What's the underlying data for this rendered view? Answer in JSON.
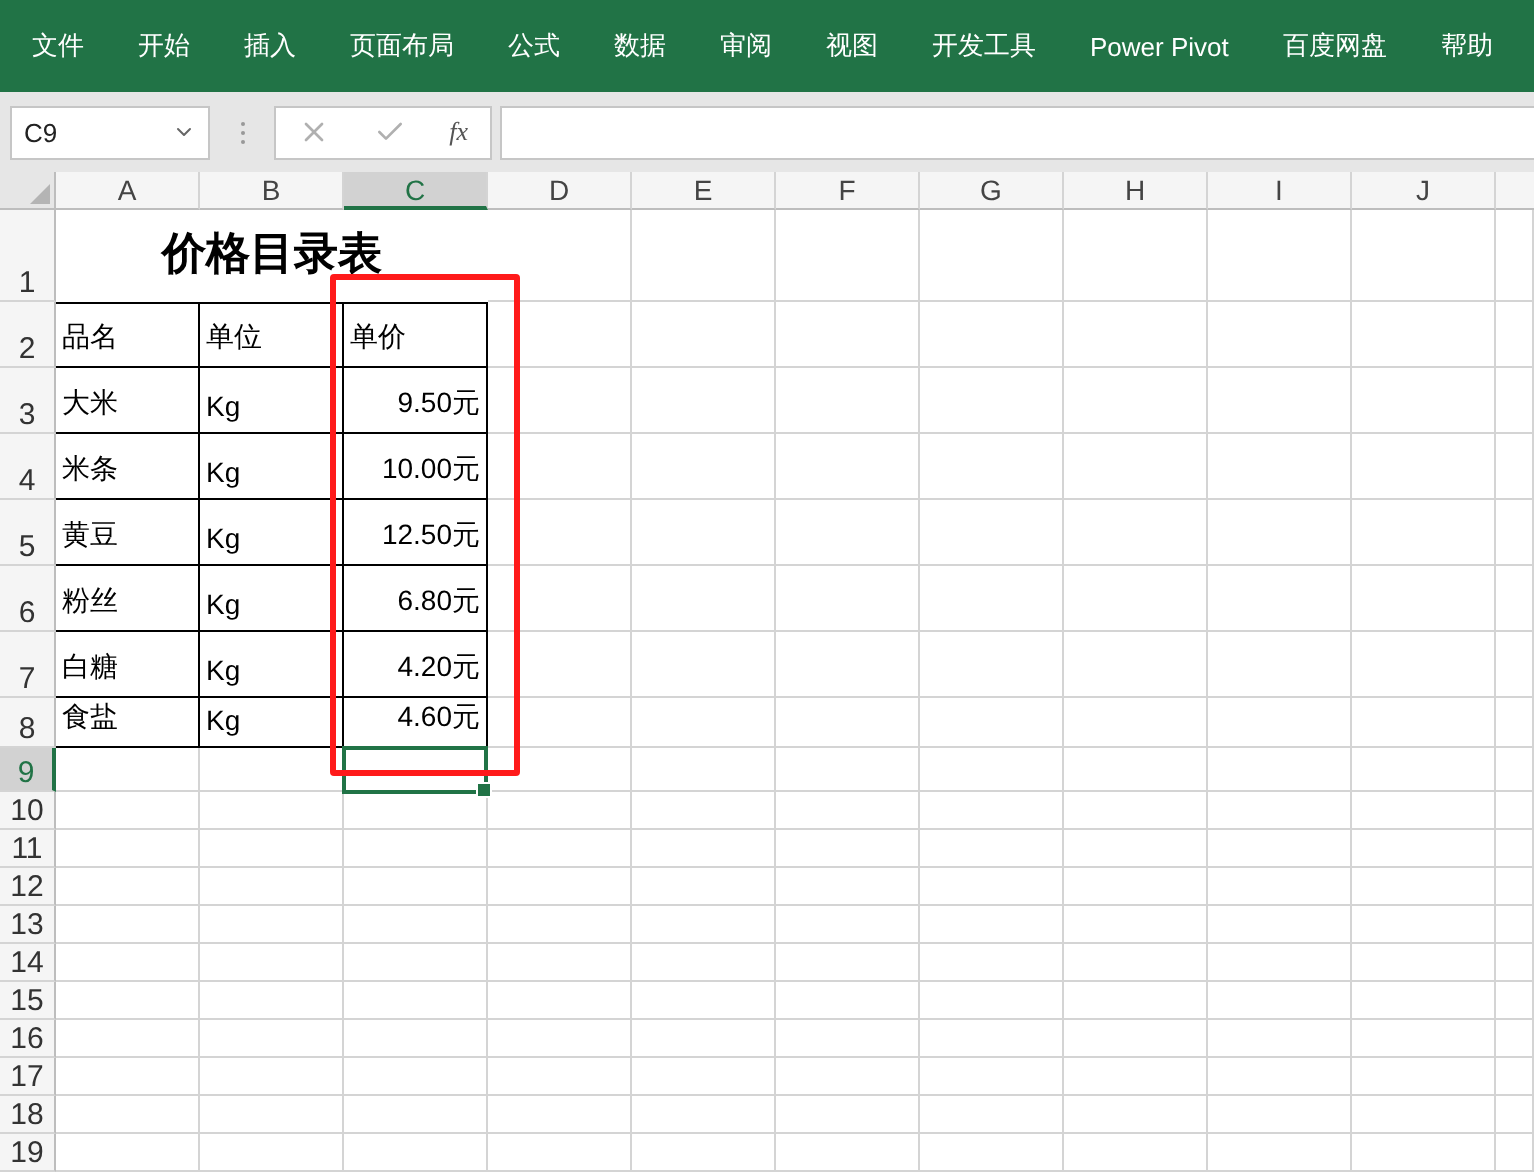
{
  "ribbon_tabs": [
    "文件",
    "开始",
    "插入",
    "页面布局",
    "公式",
    "数据",
    "审阅",
    "视图",
    "开发工具",
    "Power Pivot",
    "百度网盘",
    "帮助"
  ],
  "name_box": "C9",
  "formula_buttons": {
    "function_label": "fx"
  },
  "columns": [
    {
      "label": "A",
      "selected": false
    },
    {
      "label": "B",
      "selected": false
    },
    {
      "label": "C",
      "selected": true
    },
    {
      "label": "D",
      "selected": false
    },
    {
      "label": "E",
      "selected": false
    },
    {
      "label": "F",
      "selected": false
    },
    {
      "label": "G",
      "selected": false
    },
    {
      "label": "H",
      "selected": false
    },
    {
      "label": "I",
      "selected": false
    },
    {
      "label": "J",
      "selected": false
    }
  ],
  "rows": [
    {
      "label": "1",
      "selected": false
    },
    {
      "label": "2",
      "selected": false
    },
    {
      "label": "3",
      "selected": false
    },
    {
      "label": "4",
      "selected": false
    },
    {
      "label": "5",
      "selected": false
    },
    {
      "label": "6",
      "selected": false
    },
    {
      "label": "7",
      "selected": false
    },
    {
      "label": "8",
      "selected": false
    },
    {
      "label": "9",
      "selected": true
    },
    {
      "label": "10",
      "selected": false
    },
    {
      "label": "11",
      "selected": false
    },
    {
      "label": "12",
      "selected": false
    },
    {
      "label": "13",
      "selected": false
    },
    {
      "label": "14",
      "selected": false
    },
    {
      "label": "15",
      "selected": false
    },
    {
      "label": "16",
      "selected": false
    },
    {
      "label": "17",
      "selected": false
    },
    {
      "label": "18",
      "selected": false
    },
    {
      "label": "19",
      "selected": false
    }
  ],
  "title": "价格目录表",
  "table": {
    "header": [
      "品名",
      "单位",
      "单价"
    ],
    "rows": [
      [
        "大米",
        "Kg",
        "9.50元"
      ],
      [
        "米条",
        "Kg",
        "10.00元"
      ],
      [
        "黄豆",
        "Kg",
        "12.50元"
      ],
      [
        "粉丝",
        "Kg",
        "6.80元"
      ],
      [
        "白糖",
        "Kg",
        "4.20元"
      ],
      [
        "食盐",
        "Kg",
        "4.60元"
      ]
    ]
  },
  "annotation": {
    "kind": "rectangle"
  }
}
